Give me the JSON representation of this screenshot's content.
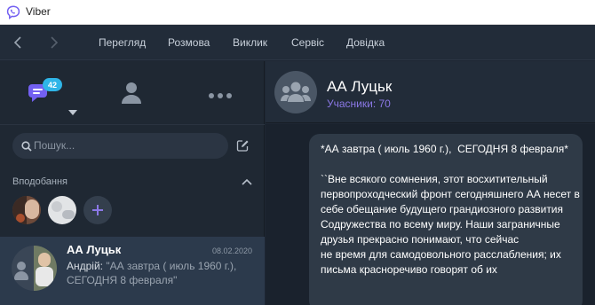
{
  "window": {
    "title": "Viber"
  },
  "menu": {
    "items": [
      "Перегляд",
      "Розмова",
      "Виклик",
      "Сервіс",
      "Довідка"
    ]
  },
  "tabs": {
    "unread_badge": "42"
  },
  "search": {
    "placeholder": "Пошук..."
  },
  "favorites": {
    "title": "Вподобання"
  },
  "chat_list": [
    {
      "name": "АА Луцьк",
      "date": "08.02.2020",
      "sender": "Андрій:",
      "preview": " \"АА завтра ( июль 1960 г.), СЕГОДНЯ 8 февраля\""
    }
  ],
  "conversation": {
    "name": "АА Луцьк",
    "members": "Учасники: 70",
    "message": "*АА завтра ( июль 1960 г.),  СЕГОДНЯ 8 февраля*\n\n``Вне всякого сомнения, этот восхитительный первопроходческий фронт сегодняшнего АА несет в себе обещание будущего грандиозного развития Содружества по всему миру. Наши заграничные друзья прекрасно понимают, что сейчас\nне время для самодовольного расслабления; их письма красноречиво говорят об их"
  },
  "colors": {
    "accent": "#7360f2",
    "badge": "#2fb5e8",
    "active_chat": "#2c3a4c",
    "members_text": "#8b78e6"
  }
}
